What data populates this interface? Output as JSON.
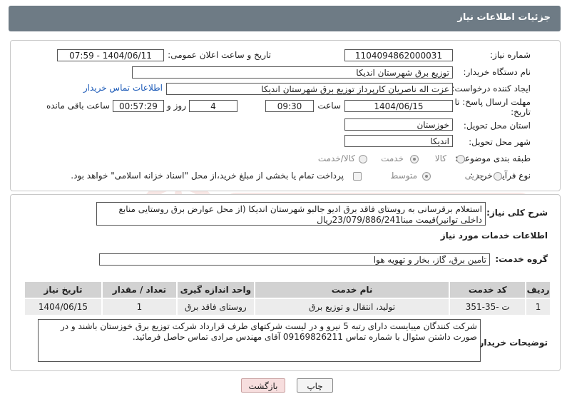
{
  "header": {
    "title": "جزئیات اطلاعات نیاز"
  },
  "form": {
    "need_number_label": "شماره نیاز:",
    "need_number": "1104094862000031",
    "announce_label": "تاریخ و ساعت اعلان عمومی:",
    "announce_value": "1404/06/11 - 07:59",
    "buyer_org_label": "نام دستگاه خریدار:",
    "buyer_org": "توزیع برق شهرستان اندیکا",
    "creator_label": "ایجاد کننده درخواست:",
    "creator": "عزت اله ناصریان کارپرداز توزیع برق شهرستان اندیکا",
    "contact_link": "اطلاعات تماس خریدار",
    "deadline_label_1": "مهلت ارسال پاسخ: تا",
    "deadline_label_2": "تاریخ:",
    "deadline_date": "1404/06/15",
    "hour_label": "ساعت",
    "deadline_time": "09:30",
    "days_value": "4",
    "days_label": "روز و",
    "remaining_time": "00:57:29",
    "remaining_label": "ساعت باقی مانده",
    "province_label": "استان محل تحویل:",
    "province": "خوزستان",
    "city_label": "شهر محل تحویل:",
    "city": "اندیکا",
    "category_label": "طبقه بندی موضوعی:",
    "category_options": [
      "کالا",
      "خدمت",
      "کالا/خدمت"
    ],
    "category_selected": "خدمت",
    "process_label": "نوع فرآیند خرید :",
    "process_options": [
      "جزیی",
      "متوسط"
    ],
    "process_selected": "جزیی",
    "payment_note": "پرداخت تمام یا بخشی از مبلغ خرید،از محل \"اسناد خزانه اسلامی\" خواهد بود."
  },
  "summary": {
    "label": "شرح کلی نیاز:",
    "text": "استعلام برقرسانی به روستای فاقد برق ادیو جالبو شهرستان  اندیکا (از محل عوارض برق روستایی منابع داخلی توانیر)قیمت مبنا23/079/886/241ریال"
  },
  "services": {
    "section_title": "اطلاعات خدمات مورد نیاز",
    "group_label": "گروه خدمت:",
    "group_value": "تامین برق، گاز، بخار و تهویه هوا",
    "columns": [
      "ردیف",
      "کد خدمت",
      "نام خدمت",
      "واحد اندازه گیری",
      "تعداد / مقدار",
      "تاریخ نیاز"
    ],
    "rows": [
      [
        "1",
        "ت -35-351",
        "تولید، انتقال و توزیع برق",
        "روستای فاقد برق",
        "1",
        "1404/06/15"
      ]
    ]
  },
  "buyer_notes": {
    "label": "توضیحات خریدار:",
    "text": "شرکت کنندگان میبایست دارای رتبه 5 نیرو و در لیست شرکتهای طرف قرارداد شرکت توزیع برق خوزستان باشند و در صورت داشتن سئوال با شماره تماس 09169826211  آقای مهندس مرادی تماس حاصل فرمائید."
  },
  "buttons": {
    "print": "چاپ",
    "back": "بازگشت"
  },
  "colors": {
    "header_bg": "#6e7b85",
    "link": "#1d5bb8",
    "back_btn": "#f7dede"
  }
}
